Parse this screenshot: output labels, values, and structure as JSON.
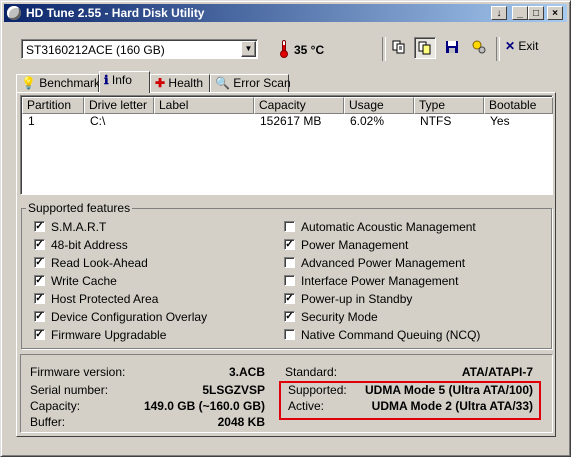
{
  "window": {
    "title": "HD Tune 2.55 - Hard Disk Utility",
    "buttons": [
      "↓",
      "_",
      "□",
      "×"
    ]
  },
  "toolbar": {
    "drive": "ST3160212ACE (160 GB)",
    "temperature": "35 °C",
    "icons": [
      "copy-text-icon",
      "copy-screenshot-icon",
      "save-icon",
      "options-icon"
    ],
    "exit_label": "Exit"
  },
  "tabs": [
    {
      "label": "Benchmark",
      "icon": "benchmark-icon"
    },
    {
      "label": "Info",
      "icon": "info-icon"
    },
    {
      "label": "Health",
      "icon": "health-icon"
    },
    {
      "label": "Error Scan",
      "icon": "search-icon"
    }
  ],
  "partitions": {
    "headers": [
      "Partition",
      "Drive letter",
      "Label",
      "Capacity",
      "Usage",
      "Type",
      "Bootable"
    ],
    "rows": [
      [
        "1",
        "C:\\",
        "",
        "152617 MB",
        "6.02%",
        "NTFS",
        "Yes"
      ]
    ]
  },
  "features": {
    "title": "Supported features",
    "left": [
      {
        "label": "S.M.A.R.T",
        "checked": true
      },
      {
        "label": "48-bit Address",
        "checked": true
      },
      {
        "label": "Read Look-Ahead",
        "checked": true
      },
      {
        "label": "Write Cache",
        "checked": true
      },
      {
        "label": "Host Protected Area",
        "checked": true
      },
      {
        "label": "Device Configuration Overlay",
        "checked": true
      },
      {
        "label": "Firmware Upgradable",
        "checked": true
      }
    ],
    "right": [
      {
        "label": "Automatic Acoustic Management",
        "checked": false
      },
      {
        "label": "Power Management",
        "checked": true
      },
      {
        "label": "Advanced Power Management",
        "checked": false
      },
      {
        "label": "Interface Power Management",
        "checked": false
      },
      {
        "label": "Power-up in Standby",
        "checked": true
      },
      {
        "label": "Security Mode",
        "checked": true
      },
      {
        "label": "Native Command Queuing (NCQ)",
        "checked": false
      }
    ]
  },
  "info": {
    "firmware_label": "Firmware version:",
    "firmware": "3.ACB",
    "serial_label": "Serial number:",
    "serial": "5LSGZVSP",
    "capacity_label": "Capacity:",
    "capacity": "149.0 GB (~160.0 GB)",
    "buffer_label": "Buffer:",
    "buffer": "2048 KB",
    "standard_label": "Standard:",
    "standard": "ATA/ATAPI-7",
    "supported_label": "Supported:",
    "supported": "UDMA Mode 5 (Ultra ATA/100)",
    "active_label": "Active:",
    "active": "UDMA Mode 2 (Ultra ATA/33)"
  },
  "colors": {
    "title_start": "#0a246a",
    "title_end": "#a6caf0",
    "highlight": "#e0000a",
    "face": "#d4d0c8"
  }
}
